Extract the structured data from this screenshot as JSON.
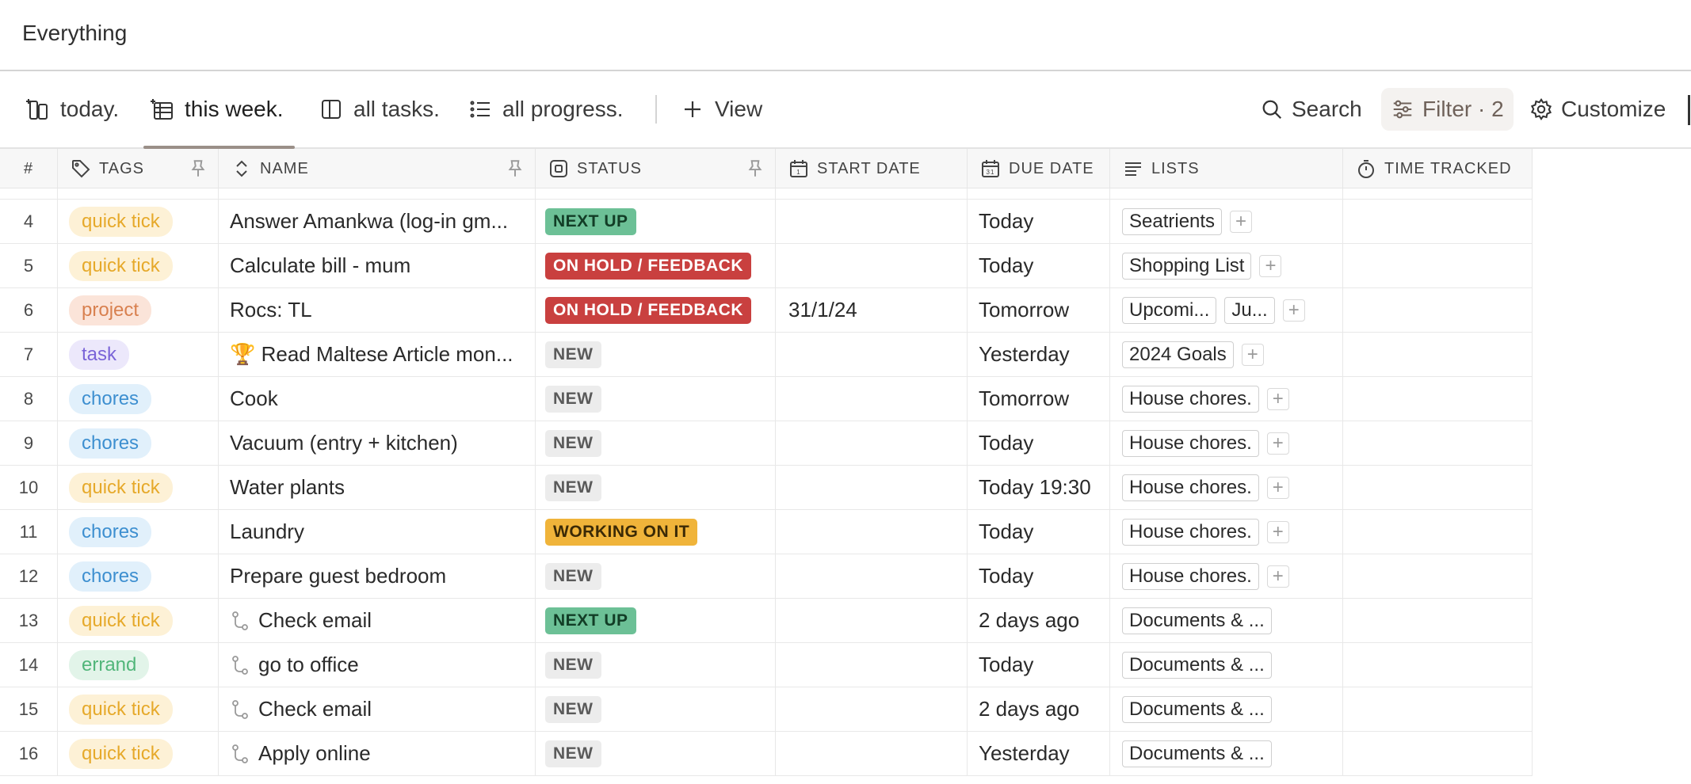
{
  "header": {
    "title": "Everything"
  },
  "views": {
    "tabs": [
      {
        "label": "today.",
        "icon": "board-icon"
      },
      {
        "label": "this week.",
        "icon": "table-icon",
        "active": true
      },
      {
        "label": "all tasks.",
        "icon": "book-icon"
      },
      {
        "label": "all progress.",
        "icon": "list-icon"
      }
    ],
    "add_view_label": "View"
  },
  "toolbar": {
    "search_label": "Search",
    "filter_label": "Filter · 2",
    "customize_label": "Customize"
  },
  "columns": {
    "num": "#",
    "tags": "TAGS",
    "name": "NAME",
    "status": "STATUS",
    "start_date": "START DATE",
    "due_date": "DUE DATE",
    "lists": "LISTS",
    "time_tracked": "TIME TRACKED"
  },
  "colors": {
    "quick_tick": "#e6a92a",
    "project": "#d8804f",
    "task": "#7a64d8",
    "chores": "#3d8fd0",
    "errand": "#52b67a",
    "next_up": "#6cc096",
    "on_hold": "#c9403f",
    "working": "#f0b43a"
  },
  "rows": [
    {
      "num": "4",
      "tag": "quick tick",
      "tag_class": "quick-tick",
      "name": "Answer Amankwa (log-in gm...",
      "status": "NEXT UP",
      "status_class": "next-up",
      "start": "",
      "due": "Today",
      "lists": [
        "Seatrients"
      ],
      "plus": true
    },
    {
      "num": "5",
      "tag": "quick tick",
      "tag_class": "quick-tick",
      "name": "Calculate bill - mum",
      "status": "ON HOLD / FEEDBACK",
      "status_class": "on-hold",
      "start": "",
      "due": "Today",
      "lists": [
        "Shopping List"
      ],
      "plus": true
    },
    {
      "num": "6",
      "tag": "project",
      "tag_class": "project",
      "name": "Rocs: TL",
      "status": "ON HOLD / FEEDBACK",
      "status_class": "on-hold",
      "start": "31/1/24",
      "due": "Tomorrow",
      "lists": [
        "Upcomi...",
        "Ju..."
      ],
      "plus": true
    },
    {
      "num": "7",
      "tag": "task",
      "tag_class": "task",
      "name": "🏆 Read Maltese Article mon...",
      "status": "NEW",
      "status_class": "new",
      "start": "",
      "due": "Yesterday",
      "lists": [
        "2024 Goals"
      ],
      "plus": true
    },
    {
      "num": "8",
      "tag": "chores",
      "tag_class": "chores",
      "name": "Cook",
      "status": "NEW",
      "status_class": "new",
      "start": "",
      "due": "Tomorrow",
      "lists": [
        "House chores."
      ],
      "plus": true
    },
    {
      "num": "9",
      "tag": "chores",
      "tag_class": "chores",
      "name": "Vacuum (entry + kitchen)",
      "status": "NEW",
      "status_class": "new",
      "start": "",
      "due": "Today",
      "lists": [
        "House chores."
      ],
      "plus": true
    },
    {
      "num": "10",
      "tag": "quick tick",
      "tag_class": "quick-tick",
      "name": "Water plants",
      "status": "NEW",
      "status_class": "new",
      "start": "",
      "due": "Today 19:30",
      "lists": [
        "House chores."
      ],
      "plus": true
    },
    {
      "num": "11",
      "tag": "chores",
      "tag_class": "chores",
      "name": "Laundry",
      "status": "WORKING ON IT",
      "status_class": "working",
      "start": "",
      "due": "Today",
      "lists": [
        "House chores."
      ],
      "plus": true
    },
    {
      "num": "12",
      "tag": "chores",
      "tag_class": "chores",
      "name": "Prepare guest bedroom",
      "status": "NEW",
      "status_class": "new",
      "start": "",
      "due": "Today",
      "lists": [
        "House chores."
      ],
      "plus": true
    },
    {
      "num": "13",
      "tag": "quick tick",
      "tag_class": "quick-tick",
      "name": "Check email",
      "subtask": true,
      "status": "NEXT UP",
      "status_class": "next-up",
      "start": "",
      "due": "2 days ago",
      "lists": [
        "Documents & ..."
      ],
      "plus": false
    },
    {
      "num": "14",
      "tag": "errand",
      "tag_class": "errand",
      "name": "go to office",
      "subtask": true,
      "status": "NEW",
      "status_class": "new",
      "start": "",
      "due": "Today",
      "lists": [
        "Documents & ..."
      ],
      "plus": false
    },
    {
      "num": "15",
      "tag": "quick tick",
      "tag_class": "quick-tick",
      "name": "Check email",
      "subtask": true,
      "status": "NEW",
      "status_class": "new",
      "start": "",
      "due": "2 days ago",
      "lists": [
        "Documents & ..."
      ],
      "plus": false
    },
    {
      "num": "16",
      "tag": "quick tick",
      "tag_class": "quick-tick",
      "name": "Apply online",
      "subtask": true,
      "status": "NEW",
      "status_class": "new",
      "start": "",
      "due": "Yesterday",
      "lists": [
        "Documents & ..."
      ],
      "plus": false
    }
  ]
}
